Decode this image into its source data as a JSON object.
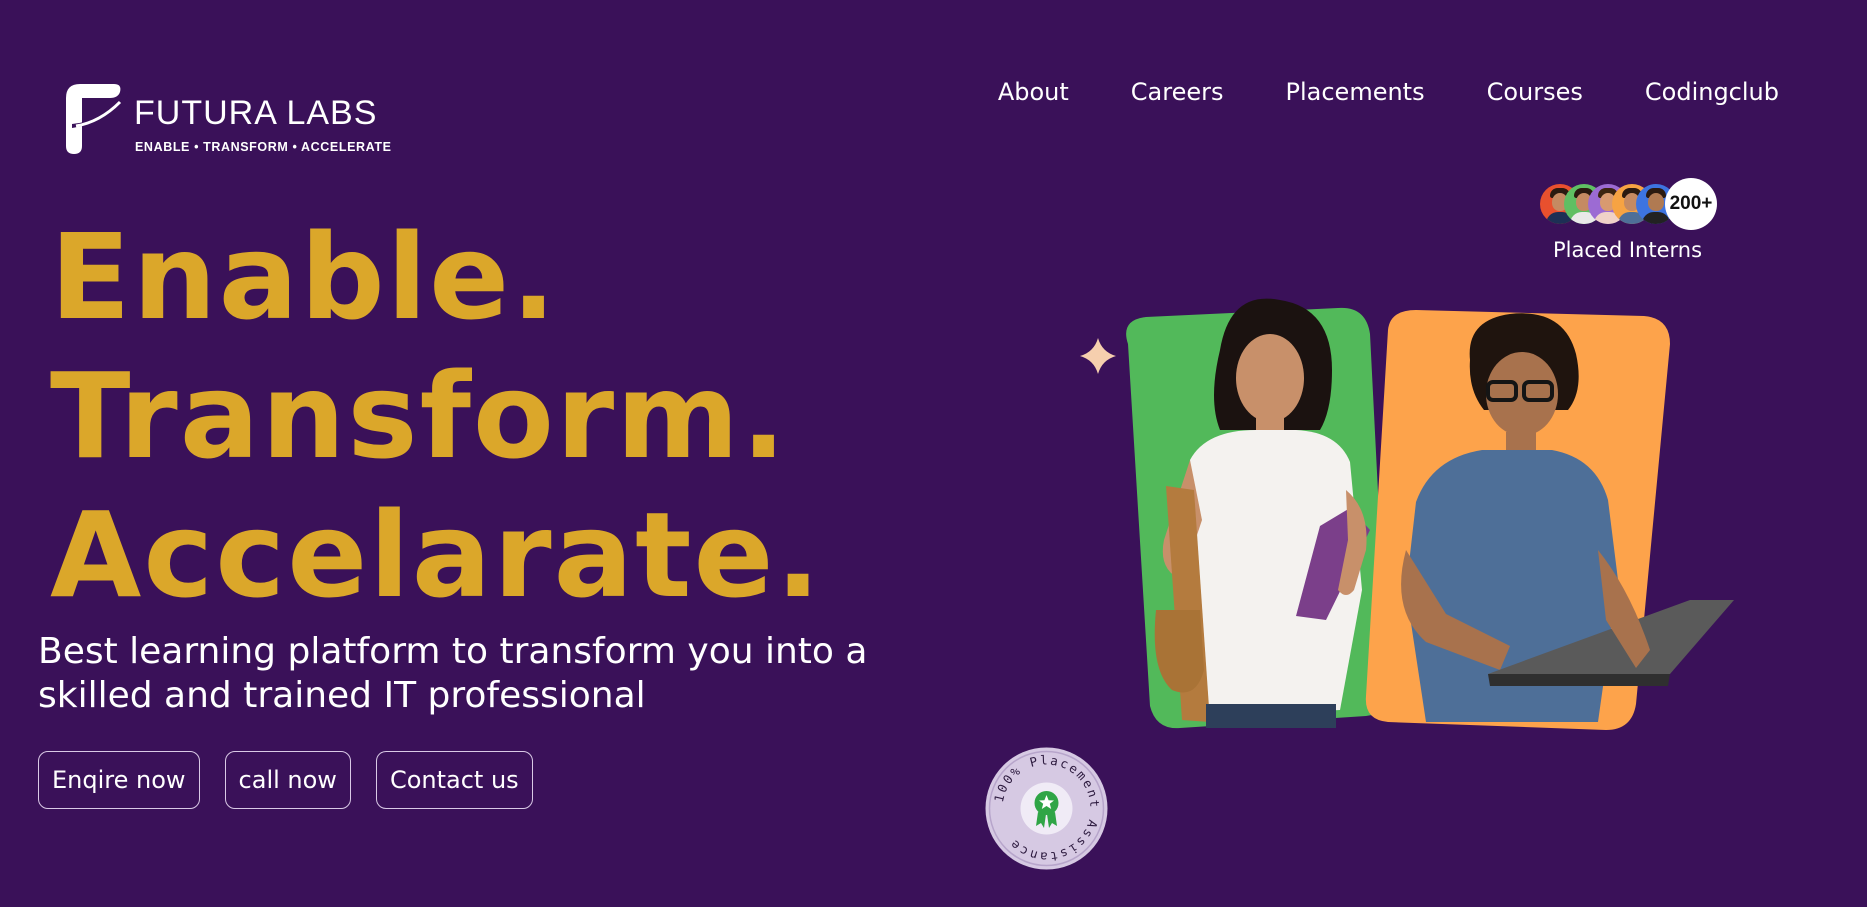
{
  "brand": {
    "name": "FUTURA LABS",
    "tagline": "ENABLE • TRANSFORM • ACCELERATE",
    "logo_icon": "futura-f-rocket-icon"
  },
  "nav": {
    "items": [
      {
        "label": "About"
      },
      {
        "label": "Careers"
      },
      {
        "label": "Placements"
      },
      {
        "label": "Courses"
      },
      {
        "label": "Codingclub"
      }
    ]
  },
  "hero": {
    "headline": [
      "Enable.",
      "Transform.",
      "Accelarate."
    ],
    "subtitle": "Best learning platform to transform you into a skilled and trained IT professional",
    "buttons": {
      "enquire": "Enqire now",
      "call": "call now",
      "contact": "Contact us"
    }
  },
  "placed_interns": {
    "count": "200+",
    "label": "Placed Interns"
  },
  "placement_badge": {
    "text": "100% Placement Assistance",
    "icon": "award-ribbon-icon"
  },
  "colors": {
    "background": "#3a1159",
    "headline": "#dba72a",
    "card_green": "#52b95a",
    "card_orange": "#fda34b"
  }
}
